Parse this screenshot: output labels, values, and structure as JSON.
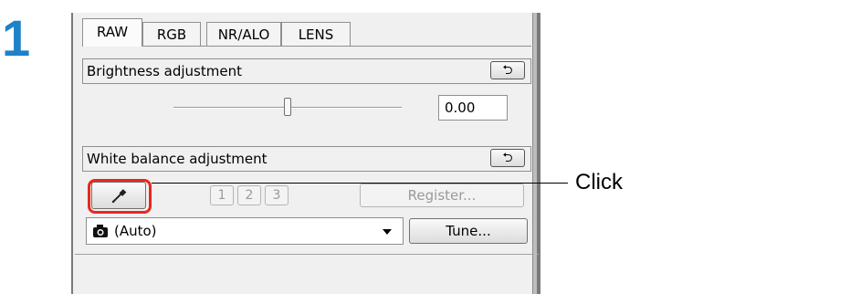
{
  "step_number": "1",
  "tabs": [
    {
      "label": "RAW",
      "active": true
    },
    {
      "label": "RGB",
      "active": false
    },
    {
      "label": "NR/ALO",
      "active": false
    },
    {
      "label": "LENS",
      "active": false
    }
  ],
  "brightness": {
    "title": "Brightness adjustment",
    "reset_icon": "reset-arrow-icon",
    "reset_glyph": "⮌",
    "value": "0.00",
    "slider_fraction": 0.5
  },
  "white_balance": {
    "title": "White balance adjustment",
    "reset_icon": "reset-arrow-icon",
    "reset_glyph": "⮌",
    "picker_icon": "eyedropper-icon",
    "slots": [
      "1",
      "2",
      "3"
    ],
    "register_label": "Register...",
    "select_value": "(Auto)",
    "select_icon": "camera-icon",
    "tune_label": "Tune..."
  },
  "annotation": {
    "label": "Click",
    "highlight_color": "#e8281e"
  },
  "colors": {
    "step_number": "#1e82c8"
  }
}
